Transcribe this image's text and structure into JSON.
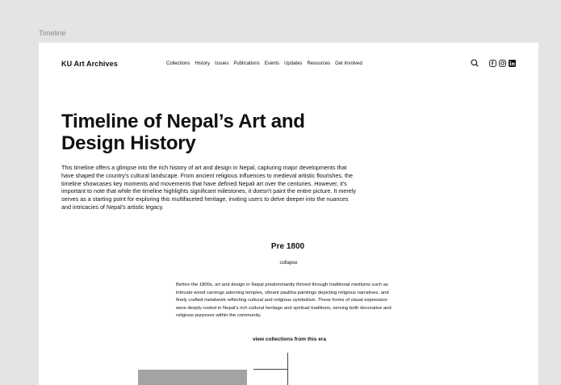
{
  "frame": {
    "label": "Timeline"
  },
  "nav": {
    "brand": "KU Art Archives",
    "menu": [
      "Collections",
      "History",
      "Issues",
      "Publications",
      "Events",
      "Updates",
      "Resources",
      "Get Involved"
    ],
    "icons": [
      "search-icon",
      "facebook-icon",
      "instagram-icon",
      "linkedin-icon"
    ]
  },
  "hero": {
    "title": "Timeline of Nepal’s Art and Design History",
    "intro": "This timeline offers a glimpse into the rich history of art and design in Nepal, capturing major developments that have shaped the country's cultural landscape. From ancient religious influences to medieval artistic flourishes, the timeline showcases key moments and movements that have defined Nepali art over the centuries. However, it's important to note that while the timeline highlights significant milestones, it doesn't paint the entire picture. It merely serves as a starting point for exploring this multifaceted heritage, inviting users to delve deeper into the nuances and intricacies of Nepal's artistic legacy."
  },
  "era": {
    "title": "Pre 1800",
    "toggle_label": "collapse",
    "description": "Before the 1800s, art and design in Nepal predominantly thrived through traditional mediums such as intricate wood carvings adorning temples, vibrant paubha paintings depicting religious narratives, and finely crafted metalwork reflecting cultural and religious symbolism. These forms of visual expression were deeply rooted in Nepal's rich cultural heritage and spiritual traditions, serving both decorative and religious purposes within the community.",
    "view_link": "view collections from this era"
  }
}
